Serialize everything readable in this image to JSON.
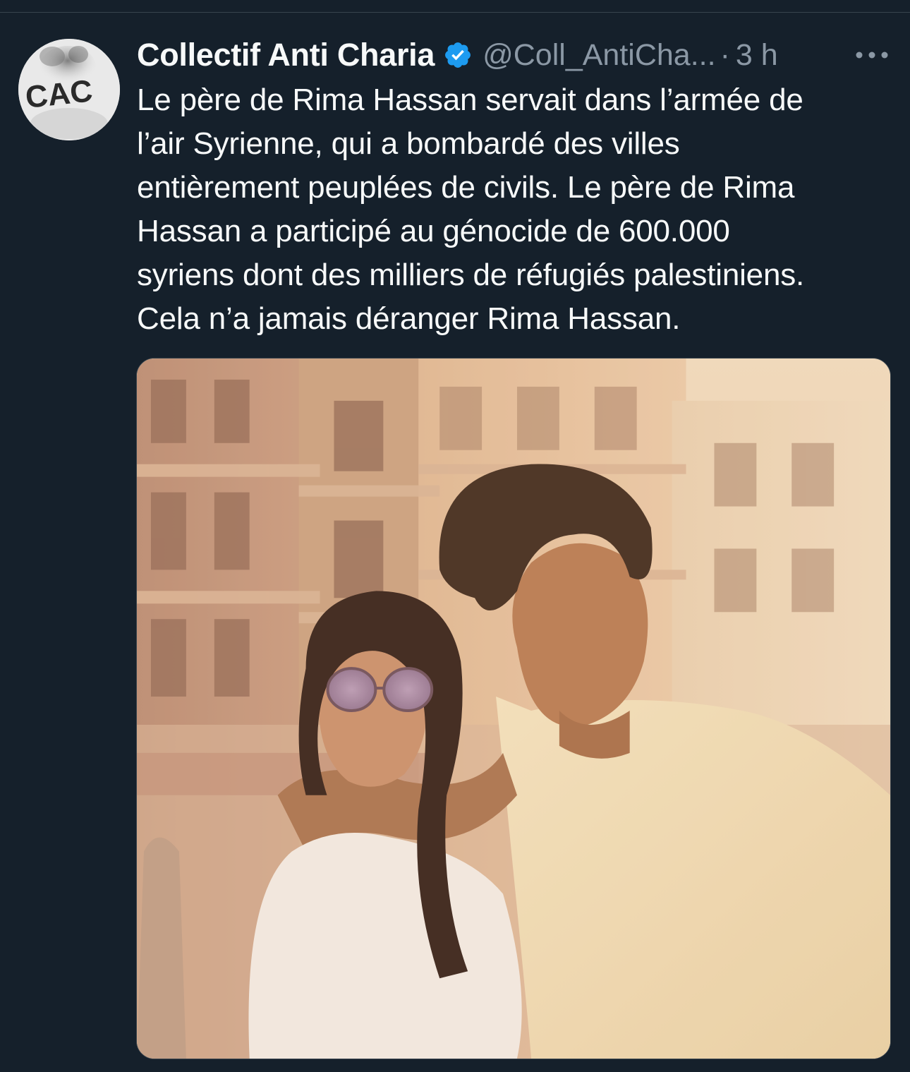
{
  "tweet": {
    "author": {
      "display_name": "Collectif Anti Charia",
      "handle": "@Coll_AntiCha...",
      "verified": true,
      "avatar_text": "CAC"
    },
    "separator": "·",
    "timestamp": "3 h",
    "more_icon": "ellipsis-icon",
    "text_lines": [
      "Le père de Rima Hassan servait dans l’armée de",
      "l’air Syrienne, qui a bombardé des villes",
      "entièrement peuplées de civils. Le père de Rima",
      "Hassan a participé au génocide de 600.000",
      "syriens dont des milliers de réfugiés palestiniens.",
      "Cela n’a jamais déranger Rima Hassan."
    ],
    "media": {
      "type": "photo"
    }
  },
  "colors": {
    "background": "#15202b",
    "primary_text": "#f7f9f9",
    "secondary_text": "#8b98a5",
    "verified_blue": "#1d9bf0",
    "border": "#38444d"
  }
}
